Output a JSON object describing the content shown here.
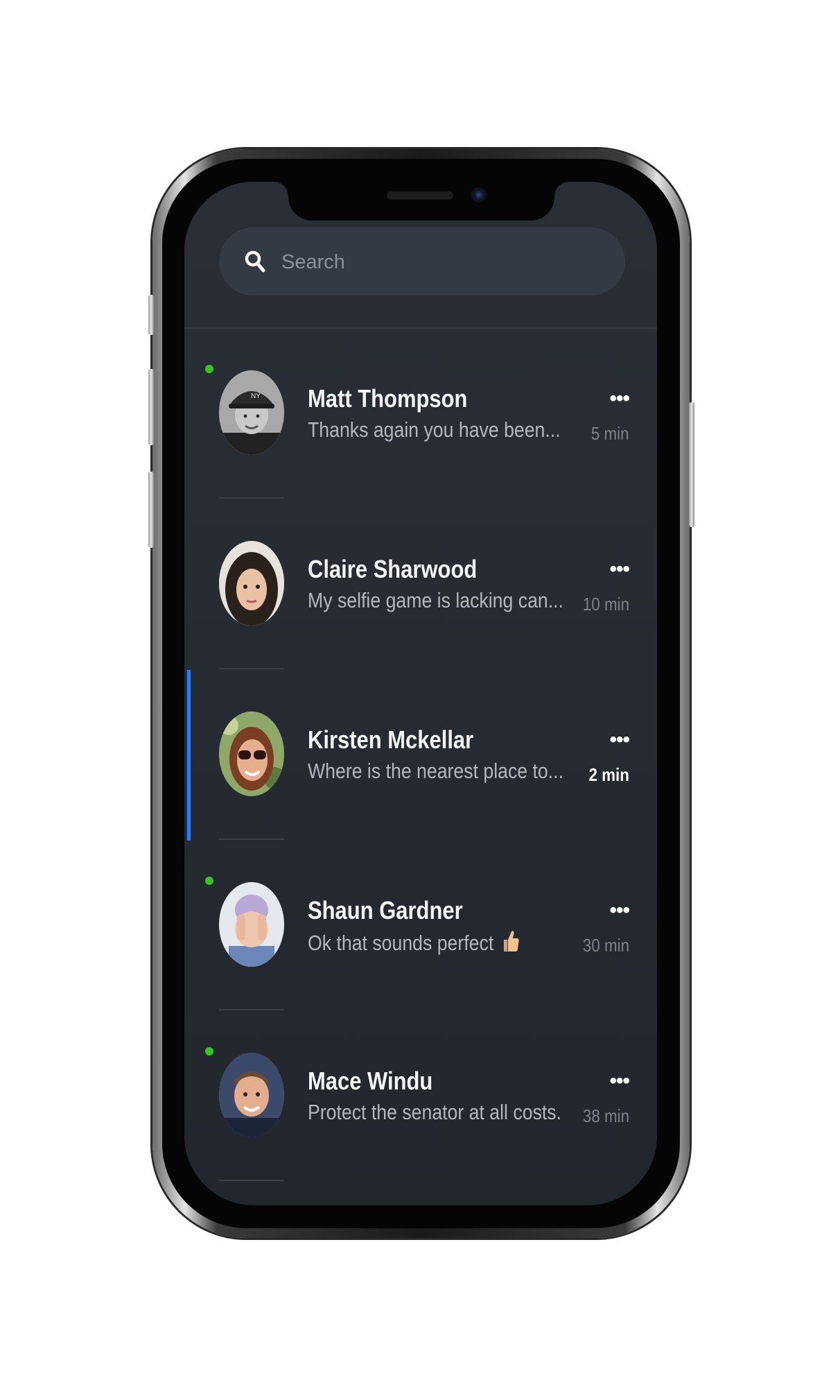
{
  "search": {
    "placeholder": "Search"
  },
  "conversations": [
    {
      "name": "Matt Thompson",
      "preview": "Thanks again you have been...",
      "time": "5 min",
      "online": true,
      "active": false,
      "avatar": "avatar-matt"
    },
    {
      "name": "Claire Sharwood",
      "preview": "My selfie game is lacking can...",
      "time": "10 min",
      "online": false,
      "active": false,
      "avatar": "avatar-claire"
    },
    {
      "name": "Kirsten Mckellar",
      "preview": "Where is the nearest place to...",
      "time": "2 min",
      "online": false,
      "active": true,
      "avatar": "avatar-kirsten"
    },
    {
      "name": "Shaun Gardner",
      "preview": "Ok that sounds perfect",
      "preview_icon": "thumbs-up-icon",
      "time": "30 min",
      "online": true,
      "active": false,
      "avatar": "avatar-shaun"
    },
    {
      "name": "Mace Windu",
      "preview": "Protect the senator at all costs.",
      "time": "38 min",
      "online": true,
      "active": false,
      "avatar": "avatar-mace"
    }
  ],
  "more_label": "•••",
  "colors": {
    "background": "#22262d",
    "search_bg": "#343a43",
    "online": "#34c724",
    "active_accent": "#2f7df6",
    "name": "#f3f4f6",
    "preview": "#b3b8c0",
    "time": "#7c838c"
  }
}
